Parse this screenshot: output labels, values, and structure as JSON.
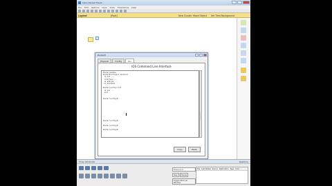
{
  "window": {
    "title": "Cisco Packet Tracer"
  },
  "menubar": [
    "File",
    "Edit",
    "Options",
    "View",
    "Tools",
    "Extensions",
    "Help"
  ],
  "navbar": {
    "logical": "Logical",
    "root": "[Root]",
    "new_cluster": "New Cluster",
    "move_object": "Move Object",
    "set_background": "Set Tiled Background"
  },
  "dialog": {
    "title": "Router0",
    "tabs": [
      "Physical",
      "Config",
      "CLI"
    ],
    "active_tab": "CLI",
    "heading": "IOS Command Line Interface",
    "console_lines": [
      "Router>enable",
      "Router#configure terminal",
      " ip nat ...",
      " interface ...",
      " ip address ...",
      " no shutdown",
      "",
      "Router(config-if)#",
      " ip nat ...",
      " exit",
      "",
      "",
      "Router(config)#",
      "",
      "",
      "",
      "",
      "",
      "",
      "",
      "",
      "",
      "Router(config)#",
      "",
      "Router(config)#",
      "",
      "Router(config)#"
    ],
    "copy_label": "Copy",
    "paste_label": "Paste"
  },
  "status": {
    "time": "Time: 00:01:09",
    "realtime": "Realtime"
  },
  "scenario": {
    "label": "Scenario 0",
    "new": "New",
    "delete": "Delete",
    "toggle": "Toggle PDU List Window"
  },
  "pdu_headers": [
    "Fire",
    "Last Status",
    "Source",
    "Destination",
    "Type",
    "Color"
  ]
}
